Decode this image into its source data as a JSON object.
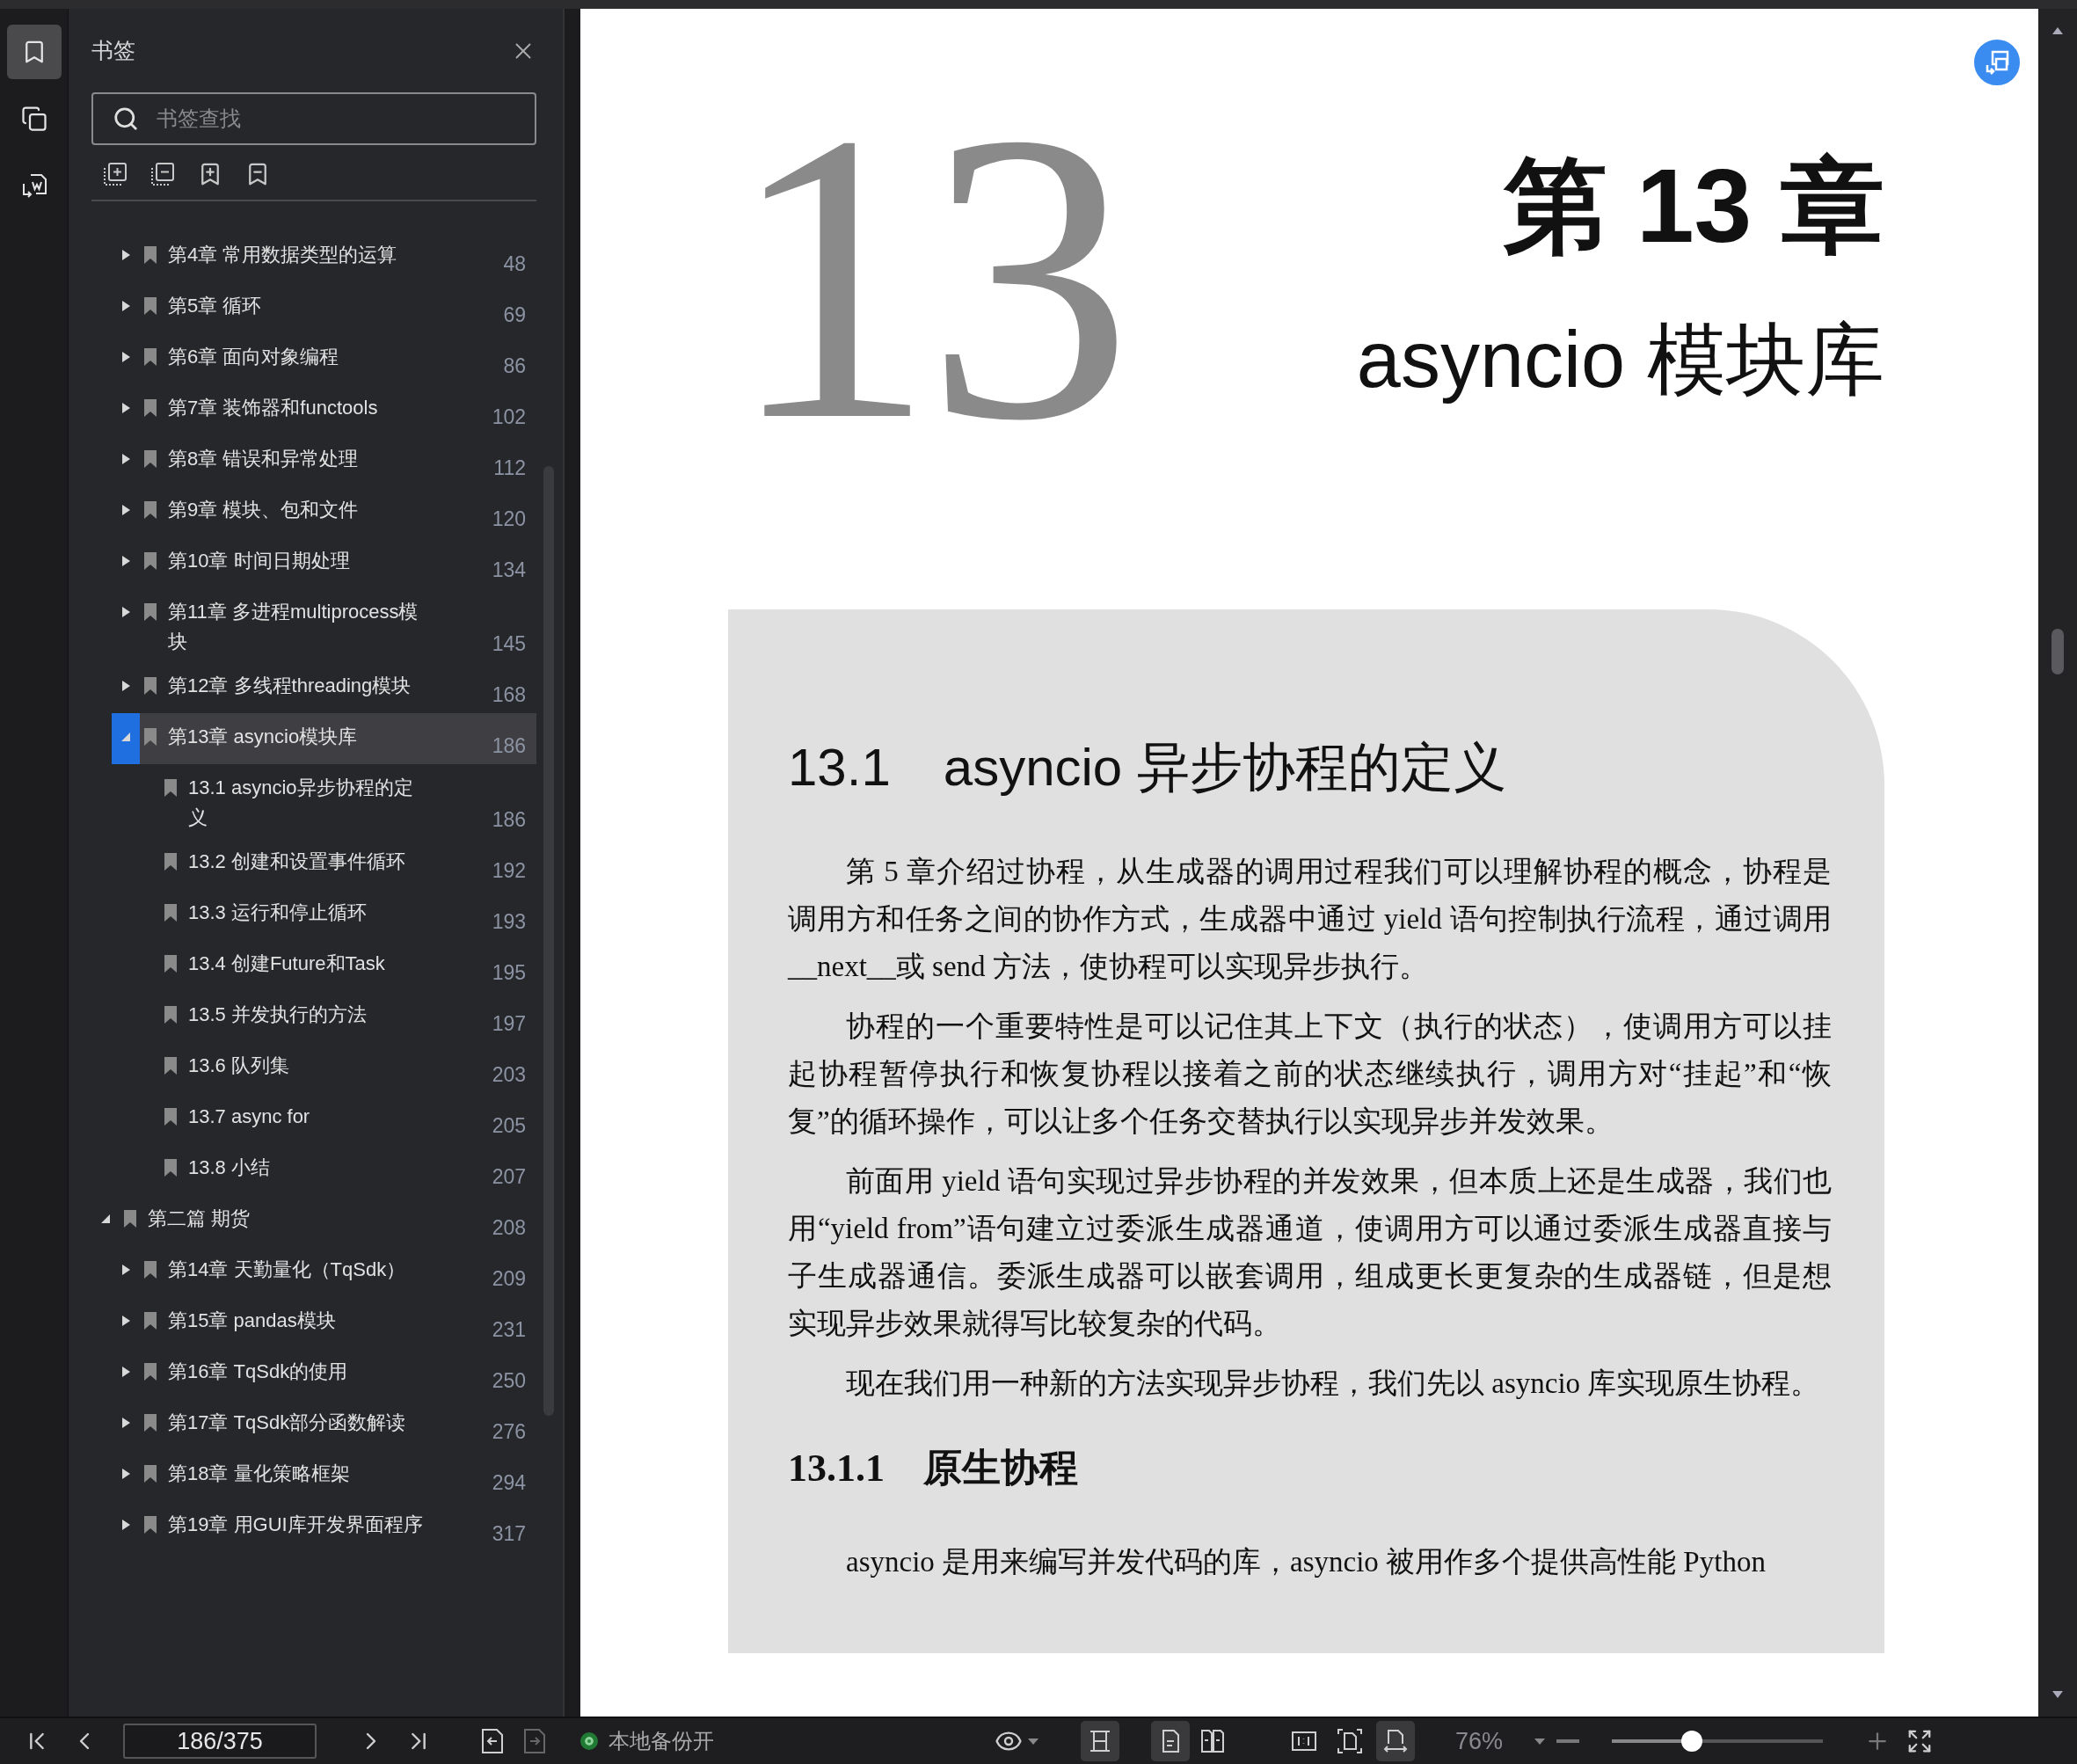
{
  "rail": [
    {
      "kind": "bookmarks",
      "selected": true
    },
    {
      "kind": "pages",
      "selected": false
    },
    {
      "kind": "convert",
      "selected": false
    }
  ],
  "sidebar": {
    "title": "书签",
    "search": {
      "placeholder": "书签查找"
    },
    "continued_items": [
      {
        "label": "第4章 常用数据类型的运算",
        "page": "48",
        "expanded": false,
        "selected": false
      },
      {
        "label": "第5章 循环",
        "page": "69",
        "expanded": false,
        "selected": false
      },
      {
        "label": "第6章 面向对象编程",
        "page": "86",
        "expanded": false,
        "selected": false
      },
      {
        "label": "第7章 装饰器和functools",
        "page": "102",
        "expanded": false,
        "selected": false
      },
      {
        "label": "第8章 错误和异常处理",
        "page": "112",
        "expanded": false,
        "selected": false
      },
      {
        "label": "第9章 模块、包和文件",
        "page": "120",
        "expanded": false,
        "selected": false
      },
      {
        "label": "第10章 时间日期处理",
        "page": "134",
        "expanded": false,
        "selected": false
      },
      {
        "label": "第11章 多进程multiprocess模块",
        "page": "145",
        "expanded": false,
        "selected": false
      },
      {
        "label": "第12章 多线程threading模块",
        "page": "168",
        "expanded": false,
        "selected": false
      },
      {
        "label": "第13章 asyncio模块库",
        "page": "186",
        "expanded": true,
        "selected": true,
        "children": [
          {
            "label": "13.1 asyncio异步协程的定义",
            "page": "186",
            "selected": false
          },
          {
            "label": "13.2 创建和设置事件循环",
            "page": "192",
            "selected": false
          },
          {
            "label": "13.3 运行和停止循环",
            "page": "193",
            "selected": false
          },
          {
            "label": "13.4 创建Future和Task",
            "page": "195",
            "selected": false
          },
          {
            "label": "13.5 并发执行的方法",
            "page": "197",
            "selected": false
          },
          {
            "label": "13.6 队列集",
            "page": "203",
            "selected": false
          },
          {
            "label": "13.7 async for",
            "page": "205",
            "selected": false
          },
          {
            "label": "13.8 小结",
            "page": "207",
            "selected": false
          }
        ]
      }
    ],
    "items": [
      {
        "label": "第二篇 期货",
        "page": "208",
        "expanded": true,
        "selected": false,
        "children": [
          {
            "label": "第14章 天勤量化（TqSdk）",
            "page": "209",
            "expanded": false,
            "selected": false
          },
          {
            "label": "第15章 pandas模块",
            "page": "231",
            "expanded": false,
            "selected": false
          },
          {
            "label": "第16章 TqSdk的使用",
            "page": "250",
            "expanded": false,
            "selected": false
          },
          {
            "label": "第17章 TqSdk部分函数解读",
            "page": "276",
            "expanded": false,
            "selected": false
          },
          {
            "label": "第18章 量化策略框架",
            "page": "294",
            "expanded": false,
            "selected": false
          },
          {
            "label": "第19章 用GUI库开发界面程序",
            "page": "317",
            "expanded": false,
            "selected": false
          }
        ]
      }
    ]
  },
  "document": {
    "chapter_number": "13",
    "chapter_title": "第 13 章",
    "chapter_subtitle": "asyncio 模块库",
    "section_heading": "13.1　asyncio 异步协程的定义",
    "paragraphs": [
      "第 5 章介绍过协程，从生成器的调用过程我们可以理解协程的概念，协程是调用方和任务之间的协作方式，生成器中通过 yield 语句控制执行流程，通过调用__next__或 send 方法，使协程可以实现异步执行。",
      "协程的一个重要特性是可以记住其上下文（执行的状态），使调用方可以挂起协程暂停执行和恢复协程以接着之前的状态继续执行，调用方对“挂起”和“恢复”的循环操作，可以让多个任务交替执行以实现异步并发效果。",
      "前面用 yield 语句实现过异步协程的并发效果，但本质上还是生成器，我们也用“yield from”语句建立过委派生成器通道，使调用方可以通过委派生成器直接与子生成器通信。委派生成器可以嵌套调用，组成更长更复杂的生成器链，但是想实现异步效果就得写比较复杂的代码。",
      "现在我们用一种新的方法实现异步协程，我们先以 asyncio 库实现原生协程。"
    ],
    "subsection_heading": "13.1.1　原生协程",
    "last_line": "asyncio 是用来编写并发代码的库，asyncio 被用作多个提供高性能 Python"
  },
  "bottom_bar": {
    "page_field": "186/375",
    "back_enabled": true,
    "forward_enabled": false,
    "backup": {
      "label": "本地备份开",
      "on": true
    },
    "layout_tools": [
      {
        "kind": "continuous",
        "selected": true
      },
      {
        "kind": "single",
        "selected": true
      },
      {
        "kind": "double",
        "selected": false
      }
    ],
    "fit_tools": [
      {
        "kind": "actual",
        "selected": false
      },
      {
        "kind": "fit-page",
        "selected": false
      },
      {
        "kind": "fit-width",
        "selected": true
      }
    ],
    "zoom": {
      "value": "76%",
      "level": 0.38
    }
  }
}
